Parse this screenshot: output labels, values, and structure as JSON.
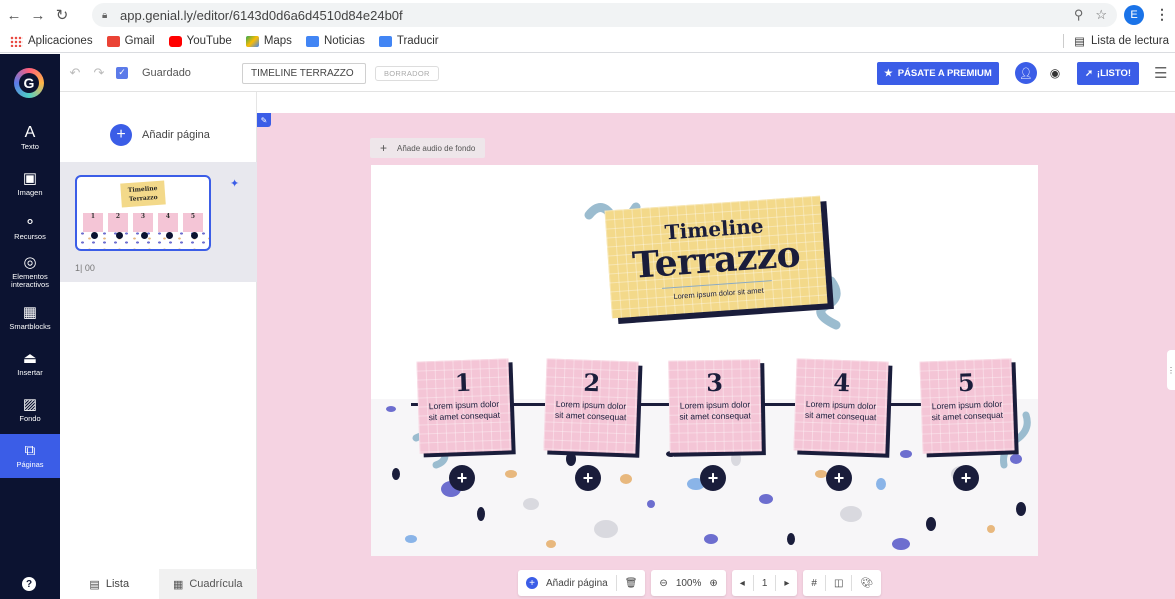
{
  "browser": {
    "url": "app.genial.ly/editor/6143d0d6a6d4510d84e24b0f",
    "profile_initial": "E"
  },
  "bookmarks": {
    "items": [
      "Aplicaciones",
      "Gmail",
      "YouTube",
      "Maps",
      "Noticias",
      "Traducir"
    ],
    "reading_list": "Lista de lectura"
  },
  "topbar": {
    "saved_label": "Guardado",
    "title_value": "TIMELINE TERRAZZO",
    "draft_badge": "BORRADOR",
    "premium_label": "PÁSATE A PREMIUM",
    "ready_label": "¡LISTO!"
  },
  "sidebar": {
    "items": [
      {
        "label": "Texto",
        "icon": "A"
      },
      {
        "label": "Imagen",
        "icon": "image-icon"
      },
      {
        "label": "Recursos",
        "icon": "resources-icon"
      },
      {
        "label": "Elementos interactivos",
        "icon": "interactive-icon"
      },
      {
        "label": "Smartblocks",
        "icon": "smartblocks-icon"
      },
      {
        "label": "Insertar",
        "icon": "insert-icon"
      },
      {
        "label": "Fondo",
        "icon": "background-icon"
      },
      {
        "label": "Páginas",
        "icon": "pages-icon"
      }
    ]
  },
  "panel": {
    "add_page_label": "Añadir página",
    "page_number": "1| 00",
    "thumb_title_1": "Timeline",
    "thumb_title_2": "Terrazzo",
    "view_list": "Lista",
    "view_grid": "Cuadrícula"
  },
  "canvas": {
    "audio_label": "Añade audio de fondo",
    "title_line_1": "Timeline",
    "title_line_2": "Terrazzo",
    "title_subtitle": "Lorem ipsum dolor sit amet",
    "cards": [
      {
        "number": "1",
        "text": "Lorem ipsum dolor sit amet consequat"
      },
      {
        "number": "2",
        "text": "Lorem ipsum dolor sit amet consequat"
      },
      {
        "number": "3",
        "text": "Lorem ipsum dolor sit amet consequat"
      },
      {
        "number": "4",
        "text": "Lorem ipsum dolor sit amet consequat"
      },
      {
        "number": "5",
        "text": "Lorem ipsum dolor sit amet consequat"
      }
    ]
  },
  "bottom_toolbar": {
    "add_page_label": "Añadir página",
    "zoom": "100%",
    "page": "1"
  },
  "colors": {
    "accent": "#3b5de7",
    "sidebar_bg": "#0c1331",
    "canvas_bg": "#f5d3e2",
    "note_yellow": "#f3d98a",
    "card_pink": "#f4c5d6",
    "navy": "#1a1d3b"
  }
}
